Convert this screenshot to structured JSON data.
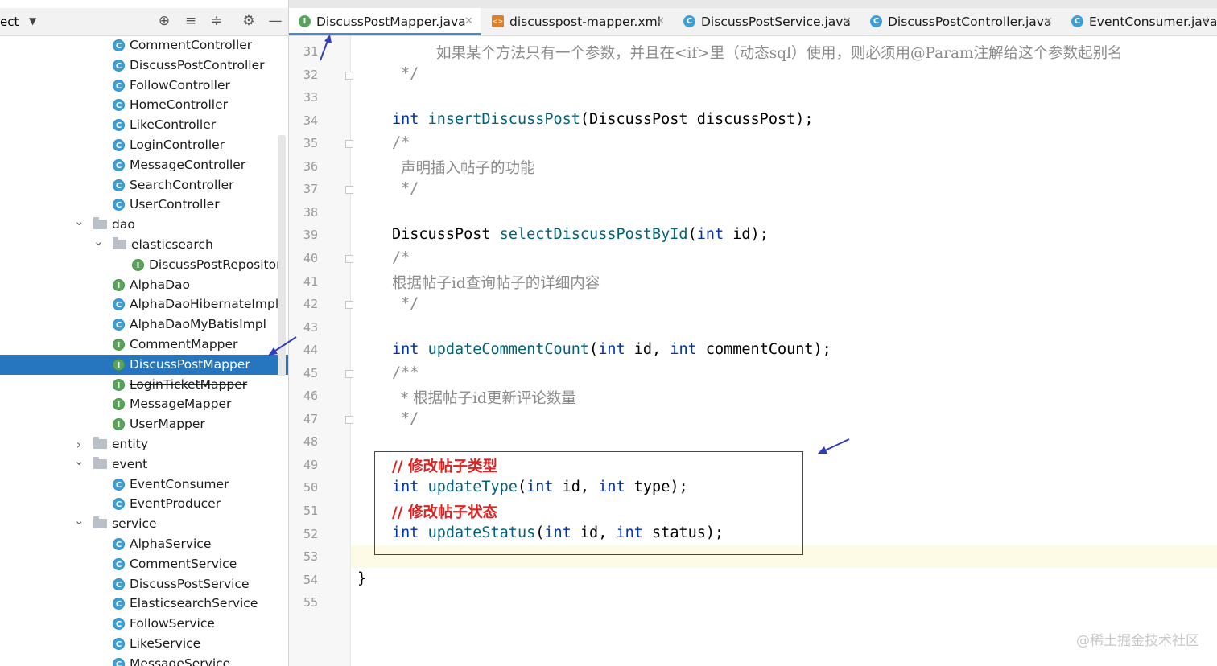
{
  "project_panel": {
    "title": "ect",
    "tree": [
      {
        "label": "CommentController",
        "kind": "class"
      },
      {
        "label": "DiscussPostController",
        "kind": "class"
      },
      {
        "label": "FollowController",
        "kind": "class"
      },
      {
        "label": "HomeController",
        "kind": "class"
      },
      {
        "label": "LikeController",
        "kind": "class"
      },
      {
        "label": "LoginController",
        "kind": "class"
      },
      {
        "label": "MessageController",
        "kind": "class"
      },
      {
        "label": "SearchController",
        "kind": "class"
      },
      {
        "label": "UserController",
        "kind": "class"
      },
      {
        "label": "dao",
        "kind": "folder",
        "expanded": true
      },
      {
        "label": "elasticsearch",
        "kind": "folder",
        "expanded": true
      },
      {
        "label": "DiscussPostRepositor",
        "kind": "interface"
      },
      {
        "label": "AlphaDao",
        "kind": "interface"
      },
      {
        "label": "AlphaDaoHibernateImpl",
        "kind": "class"
      },
      {
        "label": "AlphaDaoMyBatisImpl",
        "kind": "class"
      },
      {
        "label": "CommentMapper",
        "kind": "interface"
      },
      {
        "label": "DiscussPostMapper",
        "kind": "interface",
        "selected": true
      },
      {
        "label": "LoginTicketMapper",
        "kind": "interface",
        "deprecated": true
      },
      {
        "label": "MessageMapper",
        "kind": "interface"
      },
      {
        "label": "UserMapper",
        "kind": "interface"
      },
      {
        "label": "entity",
        "kind": "folder",
        "expanded": false
      },
      {
        "label": "event",
        "kind": "folder",
        "expanded": true
      },
      {
        "label": "EventConsumer",
        "kind": "class"
      },
      {
        "label": "EventProducer",
        "kind": "class"
      },
      {
        "label": "service",
        "kind": "folder",
        "expanded": true
      },
      {
        "label": "AlphaService",
        "kind": "class"
      },
      {
        "label": "CommentService",
        "kind": "class"
      },
      {
        "label": "DiscussPostService",
        "kind": "class"
      },
      {
        "label": "ElasticsearchService",
        "kind": "class"
      },
      {
        "label": "FollowService",
        "kind": "class"
      },
      {
        "label": "LikeService",
        "kind": "class"
      },
      {
        "label": "MessageService",
        "kind": "class"
      }
    ],
    "icons": {
      "class_badge": "C",
      "interface_badge": "I"
    }
  },
  "tabs": [
    {
      "label": "DiscussPostMapper.java",
      "icon": "interface-icon",
      "active": true
    },
    {
      "label": "discusspost-mapper.xml",
      "icon": "xml-file-icon",
      "active": false
    },
    {
      "label": "DiscussPostService.java",
      "icon": "class-icon",
      "active": false
    },
    {
      "label": "DiscussPostController.java",
      "icon": "class-icon",
      "active": false
    },
    {
      "label": "EventConsumer.java",
      "icon": "class-icon",
      "active": false
    }
  ],
  "editor": {
    "line_numbers": [
      "31",
      "32",
      "33",
      "34",
      "35",
      "36",
      "37",
      "38",
      "39",
      "40",
      "41",
      "42",
      "43",
      "44",
      "45",
      "46",
      "47",
      "48",
      "49",
      "50",
      "51",
      "52",
      "53",
      "54",
      "55"
    ],
    "code": {
      "l31_comment": "如果某个方法只有一个参数，并且在<if>里（动态sql）使用，则必须用@Param注解给这个参数起别名",
      "l32": "*/",
      "l34_kw": "int",
      "l34_fn": "insertDiscussPost",
      "l34_rest": "(DiscussPost discussPost);",
      "l35": "/*",
      "l36": "声明插入帖子的功能",
      "l37": "*/",
      "l39_type": "DiscussPost",
      "l39_fn": "selectDiscussPostById",
      "l39_kw": "int",
      "l39_rest": " id);",
      "l40": "/*",
      "l41": "根据帖子id查询帖子的详细内容",
      "l42": "*/",
      "l44_kw": "int",
      "l44_fn": "updateCommentCount",
      "l44_kw2": "int",
      "l44_mid": " id, ",
      "l44_kw3": "int",
      "l44_rest": " commentCount);",
      "l45": "/**",
      "l46": "* 根据帖子id更新评论数量",
      "l47": "*/",
      "l49": "// 修改帖子类型",
      "l50_kw": "int",
      "l50_fn": "updateType",
      "l50_kw2": "int",
      "l50_mid": " id, ",
      "l50_kw3": "int",
      "l50_rest": " type);",
      "l51": "// 修改帖子状态",
      "l52_kw": "int",
      "l52_fn": "updateStatus",
      "l52_kw2": "int",
      "l52_mid": " id, ",
      "l52_kw3": "int",
      "l52_rest": " status);",
      "l54": "}"
    }
  },
  "watermark": "@稀土掘金技术社区",
  "colors": {
    "selection": "#2675bf",
    "keyword": "#0033b3",
    "function": "#00627a",
    "comment": "#8c8c8c",
    "annotation_red": "#e02020",
    "highlight_box": "#2f3cc0"
  }
}
